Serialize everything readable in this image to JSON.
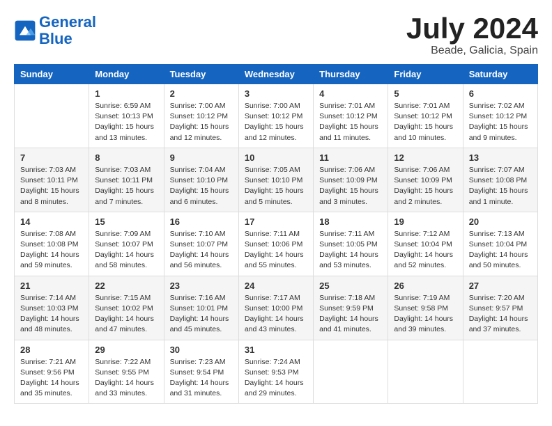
{
  "header": {
    "logo_line1": "General",
    "logo_line2": "Blue",
    "month_year": "July 2024",
    "location": "Beade, Galicia, Spain"
  },
  "columns": [
    "Sunday",
    "Monday",
    "Tuesday",
    "Wednesday",
    "Thursday",
    "Friday",
    "Saturday"
  ],
  "weeks": [
    [
      {
        "day": "",
        "info": ""
      },
      {
        "day": "1",
        "info": "Sunrise: 6:59 AM\nSunset: 10:13 PM\nDaylight: 15 hours\nand 13 minutes."
      },
      {
        "day": "2",
        "info": "Sunrise: 7:00 AM\nSunset: 10:12 PM\nDaylight: 15 hours\nand 12 minutes."
      },
      {
        "day": "3",
        "info": "Sunrise: 7:00 AM\nSunset: 10:12 PM\nDaylight: 15 hours\nand 12 minutes."
      },
      {
        "day": "4",
        "info": "Sunrise: 7:01 AM\nSunset: 10:12 PM\nDaylight: 15 hours\nand 11 minutes."
      },
      {
        "day": "5",
        "info": "Sunrise: 7:01 AM\nSunset: 10:12 PM\nDaylight: 15 hours\nand 10 minutes."
      },
      {
        "day": "6",
        "info": "Sunrise: 7:02 AM\nSunset: 10:12 PM\nDaylight: 15 hours\nand 9 minutes."
      }
    ],
    [
      {
        "day": "7",
        "info": "Sunrise: 7:03 AM\nSunset: 10:11 PM\nDaylight: 15 hours\nand 8 minutes."
      },
      {
        "day": "8",
        "info": "Sunrise: 7:03 AM\nSunset: 10:11 PM\nDaylight: 15 hours\nand 7 minutes."
      },
      {
        "day": "9",
        "info": "Sunrise: 7:04 AM\nSunset: 10:10 PM\nDaylight: 15 hours\nand 6 minutes."
      },
      {
        "day": "10",
        "info": "Sunrise: 7:05 AM\nSunset: 10:10 PM\nDaylight: 15 hours\nand 5 minutes."
      },
      {
        "day": "11",
        "info": "Sunrise: 7:06 AM\nSunset: 10:09 PM\nDaylight: 15 hours\nand 3 minutes."
      },
      {
        "day": "12",
        "info": "Sunrise: 7:06 AM\nSunset: 10:09 PM\nDaylight: 15 hours\nand 2 minutes."
      },
      {
        "day": "13",
        "info": "Sunrise: 7:07 AM\nSunset: 10:08 PM\nDaylight: 15 hours\nand 1 minute."
      }
    ],
    [
      {
        "day": "14",
        "info": "Sunrise: 7:08 AM\nSunset: 10:08 PM\nDaylight: 14 hours\nand 59 minutes."
      },
      {
        "day": "15",
        "info": "Sunrise: 7:09 AM\nSunset: 10:07 PM\nDaylight: 14 hours\nand 58 minutes."
      },
      {
        "day": "16",
        "info": "Sunrise: 7:10 AM\nSunset: 10:07 PM\nDaylight: 14 hours\nand 56 minutes."
      },
      {
        "day": "17",
        "info": "Sunrise: 7:11 AM\nSunset: 10:06 PM\nDaylight: 14 hours\nand 55 minutes."
      },
      {
        "day": "18",
        "info": "Sunrise: 7:11 AM\nSunset: 10:05 PM\nDaylight: 14 hours\nand 53 minutes."
      },
      {
        "day": "19",
        "info": "Sunrise: 7:12 AM\nSunset: 10:04 PM\nDaylight: 14 hours\nand 52 minutes."
      },
      {
        "day": "20",
        "info": "Sunrise: 7:13 AM\nSunset: 10:04 PM\nDaylight: 14 hours\nand 50 minutes."
      }
    ],
    [
      {
        "day": "21",
        "info": "Sunrise: 7:14 AM\nSunset: 10:03 PM\nDaylight: 14 hours\nand 48 minutes."
      },
      {
        "day": "22",
        "info": "Sunrise: 7:15 AM\nSunset: 10:02 PM\nDaylight: 14 hours\nand 47 minutes."
      },
      {
        "day": "23",
        "info": "Sunrise: 7:16 AM\nSunset: 10:01 PM\nDaylight: 14 hours\nand 45 minutes."
      },
      {
        "day": "24",
        "info": "Sunrise: 7:17 AM\nSunset: 10:00 PM\nDaylight: 14 hours\nand 43 minutes."
      },
      {
        "day": "25",
        "info": "Sunrise: 7:18 AM\nSunset: 9:59 PM\nDaylight: 14 hours\nand 41 minutes."
      },
      {
        "day": "26",
        "info": "Sunrise: 7:19 AM\nSunset: 9:58 PM\nDaylight: 14 hours\nand 39 minutes."
      },
      {
        "day": "27",
        "info": "Sunrise: 7:20 AM\nSunset: 9:57 PM\nDaylight: 14 hours\nand 37 minutes."
      }
    ],
    [
      {
        "day": "28",
        "info": "Sunrise: 7:21 AM\nSunset: 9:56 PM\nDaylight: 14 hours\nand 35 minutes."
      },
      {
        "day": "29",
        "info": "Sunrise: 7:22 AM\nSunset: 9:55 PM\nDaylight: 14 hours\nand 33 minutes."
      },
      {
        "day": "30",
        "info": "Sunrise: 7:23 AM\nSunset: 9:54 PM\nDaylight: 14 hours\nand 31 minutes."
      },
      {
        "day": "31",
        "info": "Sunrise: 7:24 AM\nSunset: 9:53 PM\nDaylight: 14 hours\nand 29 minutes."
      },
      {
        "day": "",
        "info": ""
      },
      {
        "day": "",
        "info": ""
      },
      {
        "day": "",
        "info": ""
      }
    ]
  ]
}
